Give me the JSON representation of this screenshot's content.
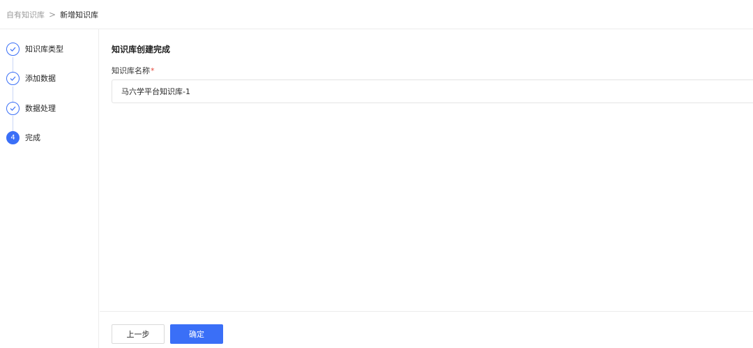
{
  "breadcrumb": {
    "parent": "自有知识库",
    "separator": ">",
    "current": "新增知识库"
  },
  "steps": [
    {
      "label": "知识库类型",
      "status": "done"
    },
    {
      "label": "添加数据",
      "status": "done"
    },
    {
      "label": "数据处理",
      "status": "done"
    },
    {
      "label": "完成",
      "status": "active",
      "number": "4"
    }
  ],
  "main": {
    "title": "知识库创建完成",
    "name_label": "知识库名称",
    "required_mark": "*",
    "name_value": "马六学平台知识库-1"
  },
  "footer": {
    "prev_label": "上一步",
    "confirm_label": "确定"
  },
  "colors": {
    "accent": "#3a6ff7",
    "required": "#e5483b"
  }
}
